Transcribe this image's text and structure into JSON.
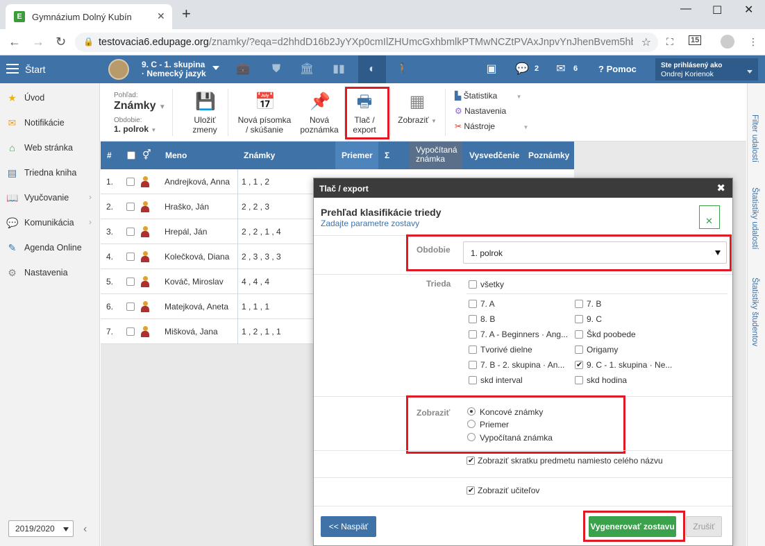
{
  "browser": {
    "tab_title": "Gymnázium Dolný Kubín",
    "url_host": "testovacia6.edupage.org",
    "url_path": "/znamky/?eqa=d2hhdD16b2JyYXp0cmIlZHUmcGxhbmlkPTMwNCZtPVAxJnpvYnJhenBvem5hbWt...",
    "ext_badge": "15"
  },
  "appbar": {
    "start_label": "Štart",
    "class_line1": "9. C - 1. skupina",
    "class_line2": "· Nemecký jazyk",
    "messages_count": "2",
    "mail_count": "6",
    "help_label": "Pomoc",
    "login_label": "Ste prihlásený ako",
    "login_user": "Ondrej Korienok"
  },
  "sidebar": {
    "items": [
      {
        "label": "Úvod",
        "icon": "star-icon"
      },
      {
        "label": "Notifikácie",
        "icon": "envelope-icon"
      },
      {
        "label": "Web stránka",
        "icon": "home-icon"
      },
      {
        "label": "Triedna kniha",
        "icon": "book-icon"
      },
      {
        "label": "Vyučovanie",
        "icon": "books-icon"
      },
      {
        "label": "Komunikácia",
        "icon": "chat-icon"
      },
      {
        "label": "Agenda Online",
        "icon": "pen-icon"
      },
      {
        "label": "Nastavenia",
        "icon": "gear-icon"
      }
    ],
    "year": "2019/2020"
  },
  "rightrail": {
    "items": [
      "Filter udalostí",
      "Štatistiky udalostí",
      "Štatistiky študentov"
    ]
  },
  "toolbar": {
    "view_caption": "Pohľad:",
    "view_value": "Známky",
    "period_caption": "Obdobie:",
    "period_value": "1. polrok",
    "save_line1": "Uložiť",
    "save_line2": "zmeny",
    "newtest_line1": "Nová písomka",
    "newtest_line2": "/ skúšanie",
    "newnote_line1": "Nová",
    "newnote_line2": "poznámka",
    "print_line1": "Tlač /",
    "print_line2": "export",
    "show_label": "Zobraziť",
    "stats_label": "Štatistika",
    "settings_label": "Nastavenia",
    "tools_label": "Nástroje"
  },
  "table": {
    "headers": {
      "num": "#",
      "name": "Meno",
      "grades": "Známky",
      "avg": "Priemer",
      "sum": "Σ",
      "calc1": "Vypočítaná",
      "calc2": "známka",
      "cert": "Vysvedčenie",
      "notes": "Poznámky"
    },
    "rows": [
      {
        "num": "1.",
        "name": "Andrejková, Anna",
        "grades": "1 ,  1 ,  2"
      },
      {
        "num": "2.",
        "name": "Hraško, Ján",
        "grades": "2 ,  2 ,  3"
      },
      {
        "num": "3.",
        "name": "Hrepál, Ján",
        "grades": "2 ,  2 ,  1 ,  4"
      },
      {
        "num": "4.",
        "name": "Kolečková, Diana",
        "grades": "2 ,  3 ,  3 ,  3"
      },
      {
        "num": "5.",
        "name": "Kováč, Miroslav",
        "grades": "4 ,  4 ,  4"
      },
      {
        "num": "6.",
        "name": "Matejková, Aneta",
        "grades": "1 ,  1 ,  1"
      },
      {
        "num": "7.",
        "name": "Mišková, Jana",
        "grades": "1 ,  2 ,  1 ,  1"
      }
    ]
  },
  "dialog": {
    "title": "Tlač / export",
    "heading": "Prehľad klasifikácie triedy",
    "subheading": "Zadajte parametre zostavy",
    "period_label": "Obdobie",
    "period_value": "1. polrok",
    "class_label": "Trieda",
    "all_label": "všetky",
    "classes": [
      {
        "label": "7. A",
        "checked": false
      },
      {
        "label": "7. B",
        "checked": false
      },
      {
        "label": "8. B",
        "checked": false
      },
      {
        "label": "9. C",
        "checked": false
      },
      {
        "label": "7. A - Beginners · Ang...",
        "checked": false
      },
      {
        "label": "Škd poobede",
        "checked": false
      },
      {
        "label": "Tvorivé dielne",
        "checked": false
      },
      {
        "label": "Origamy",
        "checked": false
      },
      {
        "label": "7. B - 2. skupina · An...",
        "checked": false
      },
      {
        "label": "9. C - 1. skupina · Ne...",
        "checked": true
      },
      {
        "label": "skd interval",
        "checked": false
      },
      {
        "label": "skd hodina",
        "checked": false
      }
    ],
    "show_label": "Zobraziť",
    "show_options": [
      {
        "label": "Koncové známky",
        "selected": true
      },
      {
        "label": "Priemer",
        "selected": false
      },
      {
        "label": "Vypočítaná známka",
        "selected": false
      }
    ],
    "abbr_label": "Zobraziť skratku predmetu namiesto celého názvu",
    "teachers_label": "Zobraziť učiteľov",
    "back_label": "<< Naspäť",
    "generate_label": "Vygenerovať zostavu",
    "cancel_label": "Zrušiť"
  }
}
